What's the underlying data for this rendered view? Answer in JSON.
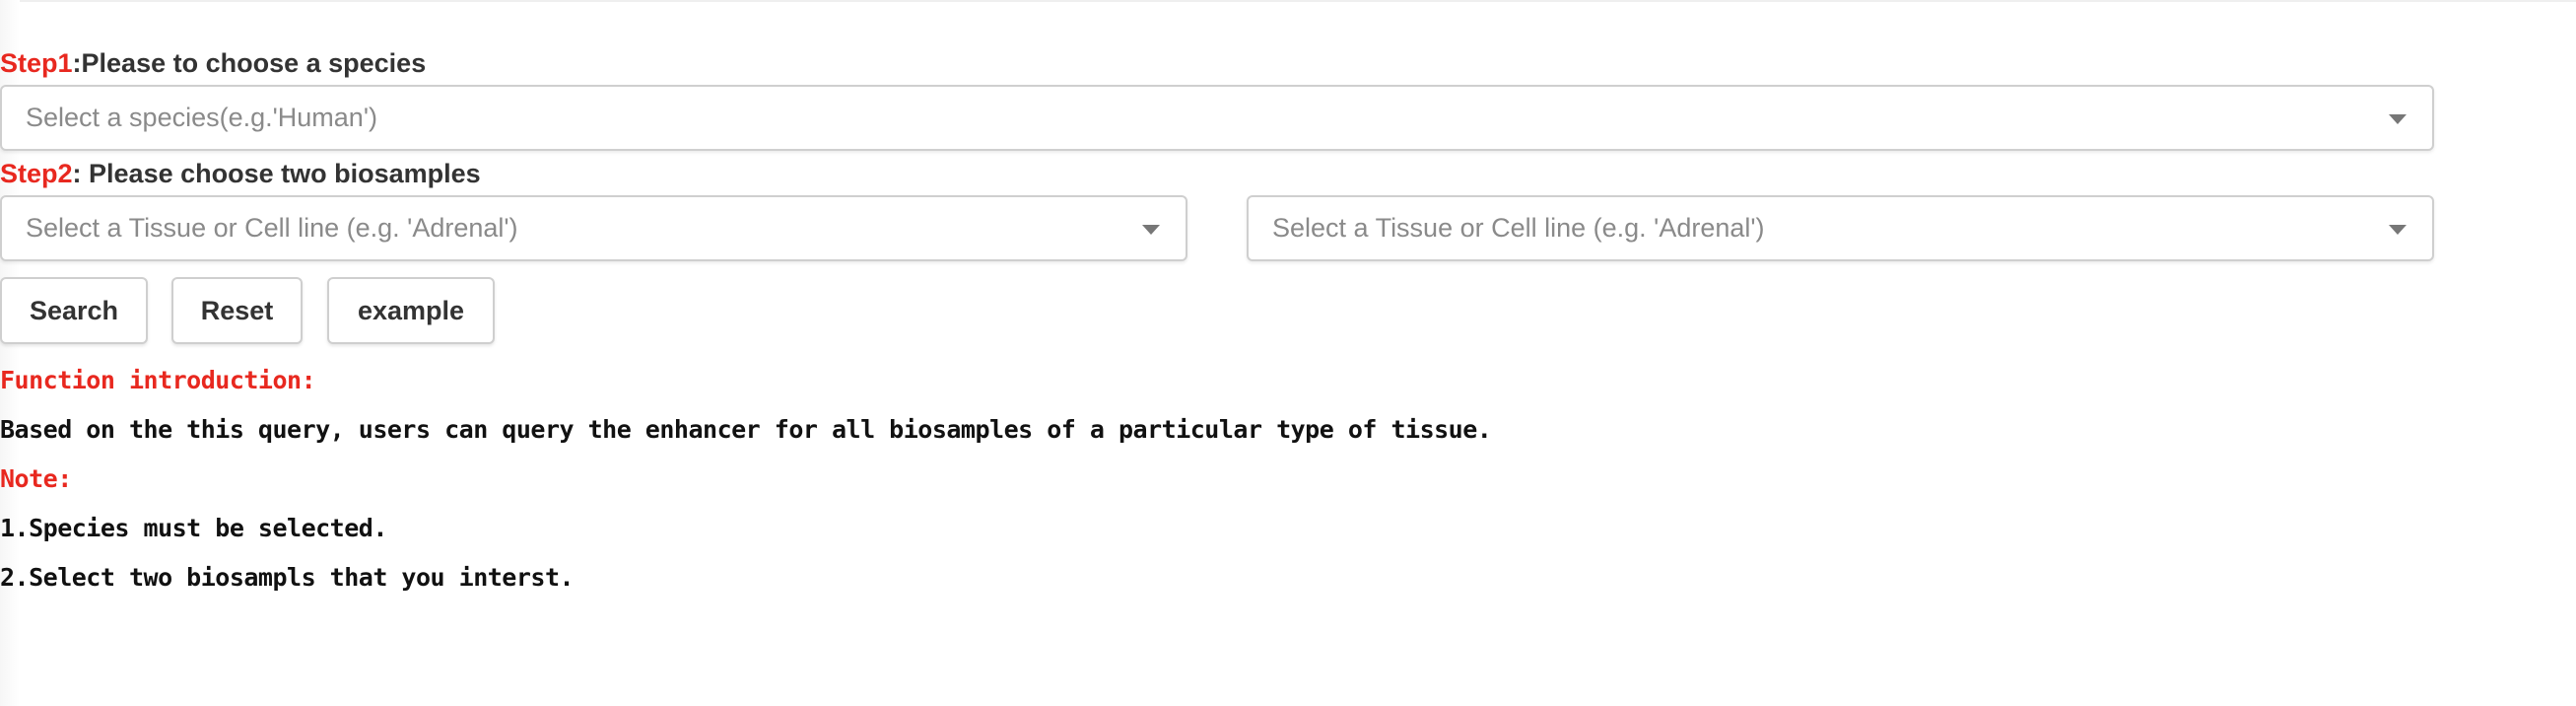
{
  "step1": {
    "num": "Step1",
    "text": ":Please to choose a species",
    "species_placeholder": "Select a species(e.g.'Human')"
  },
  "step2": {
    "num": "Step2",
    "text": ": Please choose two biosamples",
    "tissue1_placeholder": "Select a Tissue or Cell line (e.g. 'Adrenal')",
    "tissue2_placeholder": "Select a Tissue or Cell line (e.g. 'Adrenal')"
  },
  "buttons": {
    "search": "Search",
    "reset": "Reset",
    "example": "example"
  },
  "intro": {
    "heading": "Function introduction:",
    "text": "Based on the this query, users can query the enhancer for all biosamples of a particular type of tissue."
  },
  "note": {
    "heading": "Note:",
    "items": [
      "1.Species must be selected.",
      "2.Select two biosampls that you interst."
    ]
  },
  "colors": {
    "accent_red": "#e8281f",
    "text_dark": "#333333",
    "placeholder_gray": "#8a8a8a",
    "border_gray": "#cfcfcf"
  },
  "icons": {
    "dropdown": "chevron-down-icon"
  }
}
